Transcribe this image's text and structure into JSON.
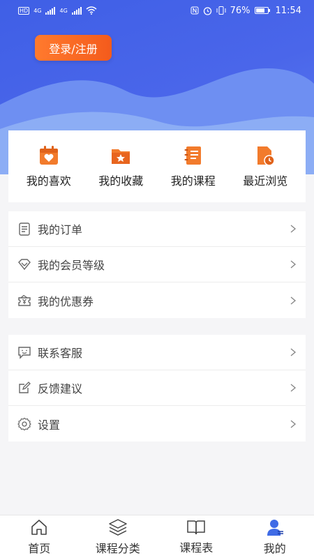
{
  "status_bar": {
    "net1": "4G",
    "net2": "4G",
    "battery_text": "76%",
    "time": "11:54",
    "icons": [
      "hd-icon",
      "signal-icon",
      "wifi-icon",
      "nfc-icon",
      "alarm-icon",
      "vibrate-icon",
      "battery-icon"
    ]
  },
  "header": {
    "login_label": "登录/注册",
    "accent_colors": [
      "#3f5fe6",
      "#f45b1c"
    ]
  },
  "quick_actions": [
    {
      "label": "我的喜欢",
      "icon": "heart-calendar-icon"
    },
    {
      "label": "我的收藏",
      "icon": "star-folder-icon"
    },
    {
      "label": "我的课程",
      "icon": "notebook-icon"
    },
    {
      "label": "最近浏览",
      "icon": "clock-document-icon"
    }
  ],
  "menu_group_1": [
    {
      "label": "我的订单",
      "icon": "order-list-icon"
    },
    {
      "label": "我的会员等级",
      "icon": "diamond-icon"
    },
    {
      "label": "我的优惠券",
      "icon": "coupon-icon"
    }
  ],
  "menu_group_2": [
    {
      "label": "联系客服",
      "icon": "chat-smile-icon"
    },
    {
      "label": "反馈建议",
      "icon": "edit-icon"
    },
    {
      "label": "设置",
      "icon": "gear-icon"
    }
  ],
  "tabbar": [
    {
      "label": "首页",
      "icon": "home-icon"
    },
    {
      "label": "课程分类",
      "icon": "layers-icon"
    },
    {
      "label": "课程表",
      "icon": "book-icon"
    },
    {
      "label": "我的",
      "icon": "user-icon",
      "active": true
    }
  ]
}
